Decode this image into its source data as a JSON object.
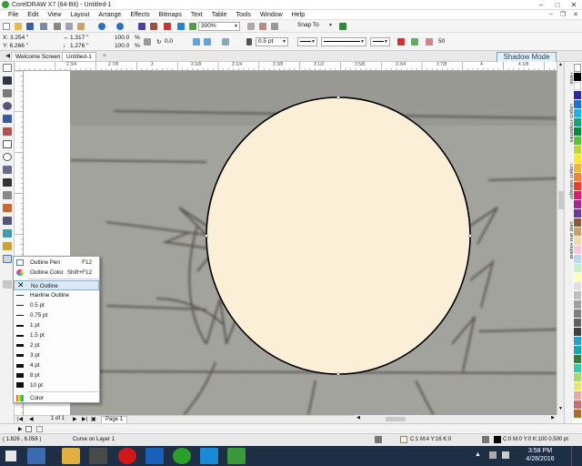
{
  "window": {
    "title": "CorelDRAW X7 (64-Bit) - Untitled-1"
  },
  "menu": [
    "File",
    "Edit",
    "View",
    "Layout",
    "Arrange",
    "Effects",
    "Bitmaps",
    "Text",
    "Table",
    "Tools",
    "Window",
    "Help"
  ],
  "toolbar": {
    "zoom": "300%",
    "snap": "Snap To"
  },
  "property_bar": {
    "x": "X: 3.254 \"",
    "y": "Y: 6.266 \"",
    "w": "1.317 \"",
    "h": "1.276 \"",
    "scale_w": "100.0",
    "scale_h": "100.0",
    "pct1": "%",
    "pct2": "%",
    "angle": "0.0",
    "outline": "0.5 pt",
    "node_count": "50"
  },
  "tabs": {
    "welcome": "Welcome Screen",
    "doc": "Untitled-1",
    "add": "+",
    "shadow_mode": "Shadow Mode"
  },
  "ruler": {
    "marks": [
      "2 3/4",
      "2 7/8",
      "3",
      "3 1/8",
      "3 1/4",
      "3 3/8",
      "3 1/2",
      "3 5/8",
      "3 3/4",
      "3 7/8",
      "4",
      "4 1/8"
    ]
  },
  "flyout": {
    "items": [
      {
        "label": "Outline Pen",
        "shortcut": "F12"
      },
      {
        "label": "Outline Color",
        "shortcut": "Shift+F12"
      },
      {
        "label": "No Outline"
      },
      {
        "label": "Hairline Outline"
      },
      {
        "label": "0.5 pt"
      },
      {
        "label": "0.75 pt"
      },
      {
        "label": "1 pt"
      },
      {
        "label": "1.5 pt"
      },
      {
        "label": "2 pt"
      },
      {
        "label": "3 pt"
      },
      {
        "label": "4 pt"
      },
      {
        "label": "8 pt"
      },
      {
        "label": "10 pt"
      },
      {
        "label": "Color"
      }
    ]
  },
  "page_nav": {
    "of": "1 of 1",
    "page": "Page 1"
  },
  "status": {
    "coords": "( 1.826 , 6.058 )",
    "layer": "Curve on Layer 1",
    "fill": "C:1 M:4 Y:16 K:0",
    "outline": "C:0 M:0 Y:0 K:100  0.500 pt"
  },
  "taskbar": {
    "time": "3:58 PM",
    "date": "4/28/2016"
  },
  "docker_tabs": [
    "Hints",
    "Object Properties",
    "Object Manager",
    "Step and Repeat"
  ],
  "colors": {
    "ellipse_fill": "#fcefd8",
    "accent": "#3a9a3a"
  }
}
